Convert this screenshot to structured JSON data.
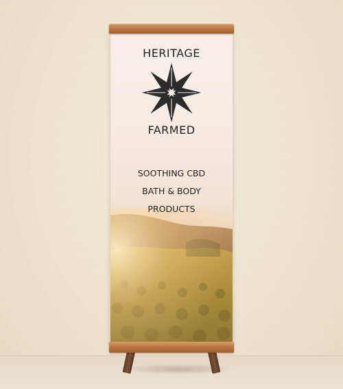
{
  "banner": {
    "brand_line1": "HERITAGE",
    "brand_line2": "FARMED",
    "tagline": [
      "SOOTHING CBD",
      "BATH & BODY",
      "PRODUCTS"
    ],
    "logo_icon": "eight-point-star-logo",
    "colors": {
      "text": "#222222",
      "wood": "#b9773f",
      "field": "#a8823c"
    }
  }
}
